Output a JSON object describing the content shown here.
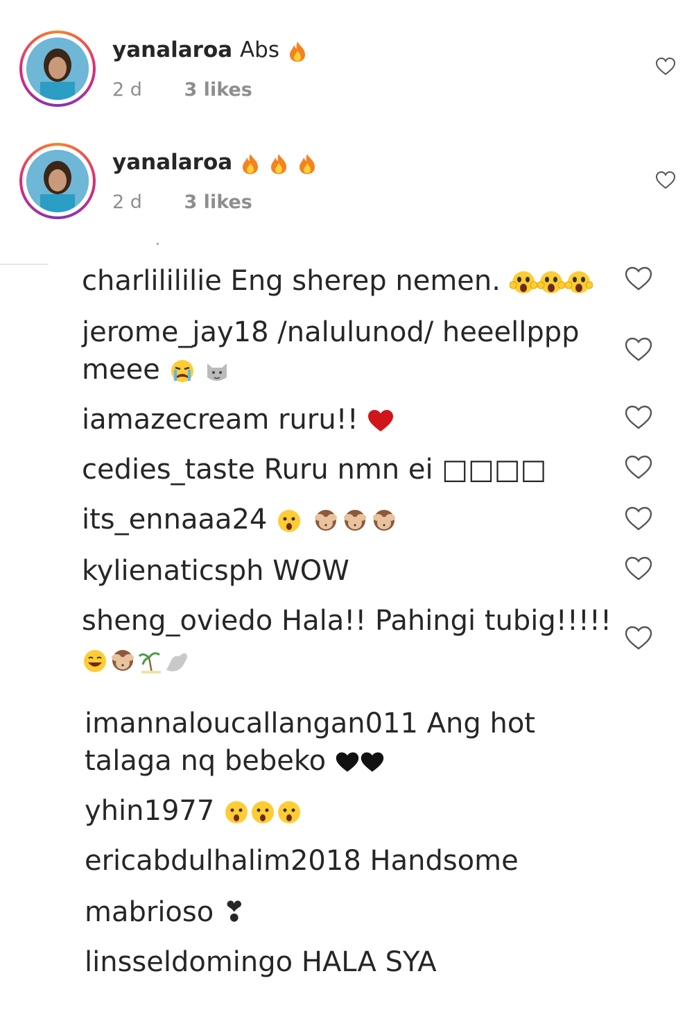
{
  "top_comments": [
    {
      "username": "yanalaroa",
      "text": "Abs",
      "time": "2 d",
      "likes": "3 likes",
      "emoji": [
        "fire"
      ]
    },
    {
      "username": "yanalaroa",
      "text": "",
      "time": "2 d",
      "likes": "3 likes",
      "emoji": [
        "fire",
        "fire",
        "fire"
      ]
    }
  ],
  "comments": [
    {
      "username": "charlilililie",
      "text": "Eng sherep nemen.",
      "emoji": [
        "scream",
        "scream",
        "scream"
      ]
    },
    {
      "username": "jerome_jay18",
      "text": "/nalulunod/ heeellppp",
      "text2": "meee",
      "emoji": [
        "cry",
        "cat"
      ]
    },
    {
      "username": "iamazecream",
      "text": "ruru!!",
      "emoji": [
        "red-heart"
      ]
    },
    {
      "username": "cedies_taste",
      "text": "Ruru nmn ei □□□□",
      "emoji": []
    },
    {
      "username": "its_ennaaa24",
      "text": "",
      "emoji": [
        "astonished",
        "monkey",
        "monkey",
        "monkey"
      ]
    },
    {
      "username": "kylienaticsph",
      "text": "WOW",
      "emoji": []
    },
    {
      "username": "sheng_oviedo",
      "text": "Hala!! Pahingi tubig!!!!!",
      "emoji": [
        "grin",
        "monkey",
        "beach",
        "arm"
      ]
    },
    {
      "username": "imannaloucallangan011",
      "text": "Ang hot",
      "text2": "talaga nq bebeko",
      "emoji": [
        "black-heart",
        "black-heart"
      ]
    },
    {
      "username": "yhin1977",
      "text": "",
      "emoji": [
        "astonished",
        "astonished",
        "astonished"
      ]
    },
    {
      "username": "ericabdulhalim2018",
      "text": "Handsome",
      "emoji": []
    },
    {
      "username": "mabrioso",
      "text": "❣",
      "emoji": []
    },
    {
      "username": "linsseldomingo",
      "text": "HALA SYA",
      "emoji": []
    }
  ]
}
